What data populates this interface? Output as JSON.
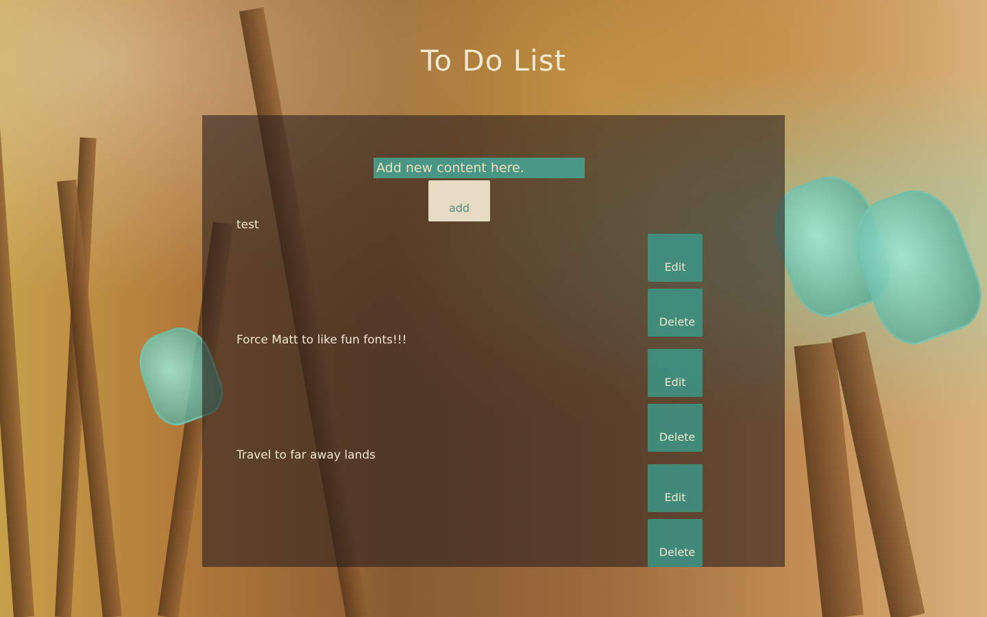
{
  "header": {
    "title": "To Do List"
  },
  "new_item": {
    "placeholder": "Add new content here.",
    "add_label": "add"
  },
  "todos": [
    {
      "text": "test",
      "edit_label": "Edit",
      "delete_label": "Delete"
    },
    {
      "text": "Force Matt to like fun fonts!!!",
      "edit_label": "Edit",
      "delete_label": "Delete"
    },
    {
      "text": "Travel to far away lands",
      "edit_label": "Edit",
      "delete_label": "Delete"
    }
  ],
  "colors": {
    "title": "#f3e9d3",
    "panel": "#281e1e",
    "input_bg": "#46a596",
    "accent_teal": "#3c9687",
    "add_button_bg": "#e6dcc3"
  }
}
